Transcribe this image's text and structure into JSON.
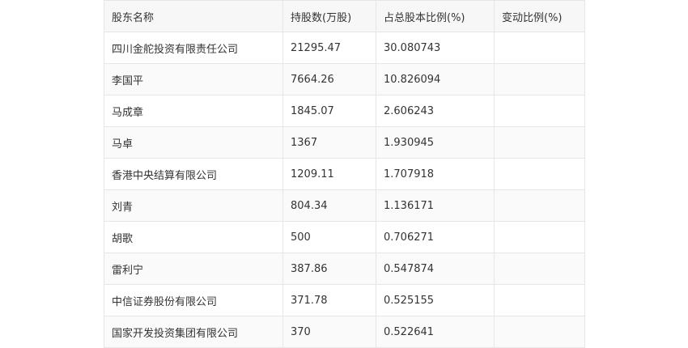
{
  "table": {
    "headers": [
      "股东名称",
      "持股数(万股)",
      "占总股本比例(%)",
      "变动比例(%)"
    ],
    "rows": [
      [
        "四川金舵投资有限责任公司",
        "21295.47",
        "30.080743",
        ""
      ],
      [
        "李国平",
        "7664.26",
        "10.826094",
        ""
      ],
      [
        "马成章",
        "1845.07",
        "2.606243",
        ""
      ],
      [
        "马卓",
        "1367",
        "1.930945",
        ""
      ],
      [
        "香港中央结算有限公司",
        "1209.11",
        "1.707918",
        ""
      ],
      [
        "刘青",
        "804.34",
        "1.136171",
        ""
      ],
      [
        "胡歌",
        "500",
        "0.706271",
        ""
      ],
      [
        "雷利宁",
        "387.86",
        "0.547874",
        ""
      ],
      [
        "中信证券股份有限公司",
        "371.78",
        "0.525155",
        ""
      ],
      [
        "国家开发投资集团有限公司",
        "370",
        "0.522641",
        ""
      ]
    ]
  }
}
